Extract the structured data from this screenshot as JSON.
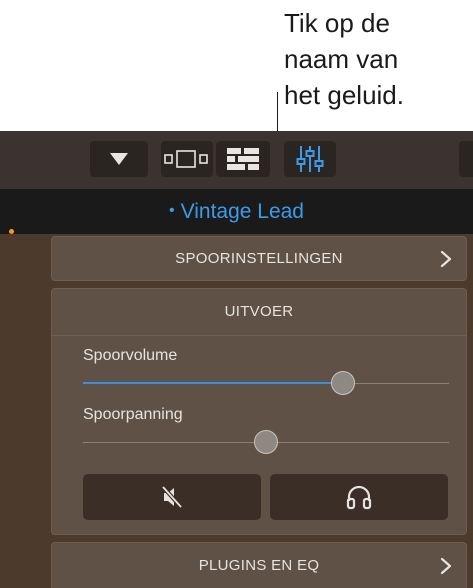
{
  "callout": {
    "text": "Tik op de\nnaam van\nhet geluid."
  },
  "toolbar": {
    "buttons": [
      {
        "icon": "triangle-down-icon"
      },
      {
        "icon": "view-toggle-icon"
      },
      {
        "icon": "tracks-view-icon"
      },
      {
        "icon": "mixer-sliders-icon"
      }
    ]
  },
  "track": {
    "bullet": "•",
    "name": "Vintage Lead"
  },
  "sections": {
    "track_settings": "SPOORINSTELLINGEN",
    "output": "UITVOER",
    "plugins_eq": "PLUGINS EN EQ"
  },
  "output": {
    "volume_label": "Spoorvolume",
    "volume_level": 0.71,
    "pan_label": "Spoorpanning",
    "pan_level": 0.5,
    "mute_icon": "speaker-muted-icon",
    "solo_icon": "headphones-icon"
  },
  "colors": {
    "accent": "#3c9be8",
    "highlight_dot": "#f39a1f",
    "background": "#4c3b2c"
  }
}
